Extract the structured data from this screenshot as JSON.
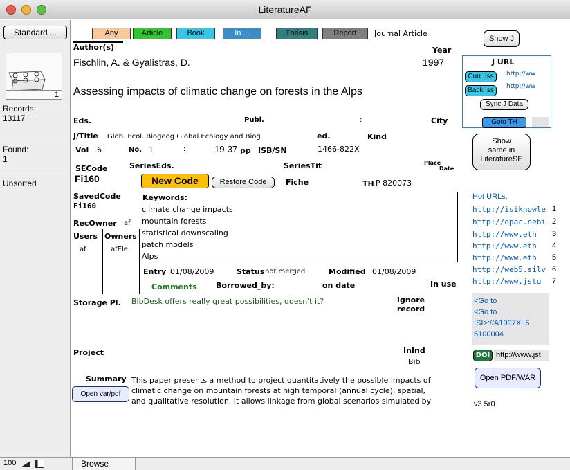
{
  "window": {
    "title": "LiteratureAF"
  },
  "sidebar": {
    "layout_button": "Standard ...",
    "book_count": "1",
    "records_label": "Records:",
    "records_value": "13117",
    "found_label": "Found:",
    "found_value": "1",
    "sort_status": "Unsorted"
  },
  "status_bar": {
    "zoom": "100",
    "mode": "Browse"
  },
  "type_buttons": [
    {
      "label": "Any",
      "color": "#f7c89a"
    },
    {
      "label": "Article",
      "color": "#2ec72e"
    },
    {
      "label": "Book",
      "color": "#33c8e8"
    },
    {
      "label": "In ...",
      "color": "#3a8ec8"
    },
    {
      "label": "Thesis",
      "color": "#2e7f7f"
    },
    {
      "label": "Report",
      "color": "#7f7f7f"
    }
  ],
  "record_type": "Journal Article",
  "author": {
    "label": "Author(s)",
    "value": "Fischlin, A. & Gyalistras, D."
  },
  "year": {
    "label": "Year",
    "value": "1997"
  },
  "title": "Assessing impacts of climatic change on forests in the Alps",
  "eds_label": "Eds.",
  "publ_label": "Publ.",
  "colon": ":",
  "city_label": "City",
  "jtitle": {
    "label": "J/Title",
    "value": "Glob. Ecol. Biogeog Global Ecology and Biog"
  },
  "ed_label": "ed.",
  "kind_label": "Kind",
  "vol": {
    "label": "Vol",
    "value": "6"
  },
  "no": {
    "label": "No.",
    "value": "1"
  },
  "pages": {
    "value": "19-37",
    "label": "pp"
  },
  "isbn": {
    "label": "ISB/SN",
    "value": "1466-822X"
  },
  "place_label": "Place",
  "date_label": "Date",
  "secode": {
    "label": "SECode",
    "value": "Fi160"
  },
  "series_eds_label": "SeriesEds.",
  "series_tit_label": "SeriesTit",
  "new_code_button": "New Code",
  "restore_code_button": "Restore Code",
  "fiche_label": "Fiche",
  "th": {
    "label": "TH",
    "value": "P 820073"
  },
  "saved_code": {
    "label": "SavedCode",
    "value": "Fi160"
  },
  "rec_owner": {
    "label": "RecOwner",
    "value": "af"
  },
  "users": {
    "label": "Users",
    "value": "af"
  },
  "owners": {
    "label": "Owners",
    "value": "afEle"
  },
  "keywords": {
    "label": "Keywords:",
    "items": [
      "climate change impacts",
      "mountain forests",
      "statistical downscaling",
      "patch models",
      "Alps"
    ]
  },
  "entry": {
    "label": "Entry",
    "value": "01/08/2009"
  },
  "status": {
    "label": "Status",
    "value": "not merged"
  },
  "modified": {
    "label": "Modified",
    "value": "01/08/2009"
  },
  "comments_label": "Comments",
  "borrowed_label": "Borrowed_by:",
  "on_date_label": "on date",
  "in_use_label": "In use",
  "storage": {
    "label": "Storage Pl.",
    "value": "BibDesk offers really great possibilities, doesn't it?"
  },
  "ignore_record_label": "Ignore record",
  "project_label": "Project",
  "inind_label": "InInd",
  "bib_label": "Bib",
  "summary": {
    "label": "Summary",
    "lines": [
      "This paper presents a method to project quantitatively the possible impacts of",
      "climatic change on mountain forests at high temporal (annual cycle), spatial,",
      "and qualitative resolution. It allows linkage from global scenarios simulated by"
    ]
  },
  "open_var_pdf_button": "Open var/pdf",
  "right_panel": {
    "show_j_button": "Show J",
    "jurl_label": "J URL",
    "curr_iss_button": "Curr. Iss",
    "back_iss_button": "Back Iss",
    "jurl_link_1": "http://ww",
    "jurl_link_2": "http://ww",
    "sync_button": "Sync J Data",
    "goto_th_button": "Goto TH",
    "show_same_lines": [
      "Show",
      "same in",
      "LiteratureSE"
    ],
    "hot_urls_label": "Hot URLs:",
    "hot_urls": [
      {
        "url": "http://isiknowle",
        "n": "1"
      },
      {
        "url": "http://opac.nebi",
        "n": "2"
      },
      {
        "url": "http://www.eth",
        "n": "3"
      },
      {
        "url": "http://www.eth",
        "n": "4"
      },
      {
        "url": "http://www.eth",
        "n": "5"
      },
      {
        "url": "http://web5.silv",
        "n": "6"
      },
      {
        "url": "http://www.jsto",
        "n": "7"
      }
    ],
    "goto_lines": [
      "<Go to",
      "<Go to",
      "ISI>://A1997XL6",
      "5100004"
    ],
    "doi_button": "DOI",
    "doi_url": "http://www.jst",
    "open_pdf_war_button": "Open PDF/WAR",
    "version": "v3.5r0"
  },
  "colors": {
    "new_code_bg": "#ffc000",
    "link": "#0058c0",
    "jurl_border": "#2b7fd4",
    "comments": "#1a7a1a"
  }
}
